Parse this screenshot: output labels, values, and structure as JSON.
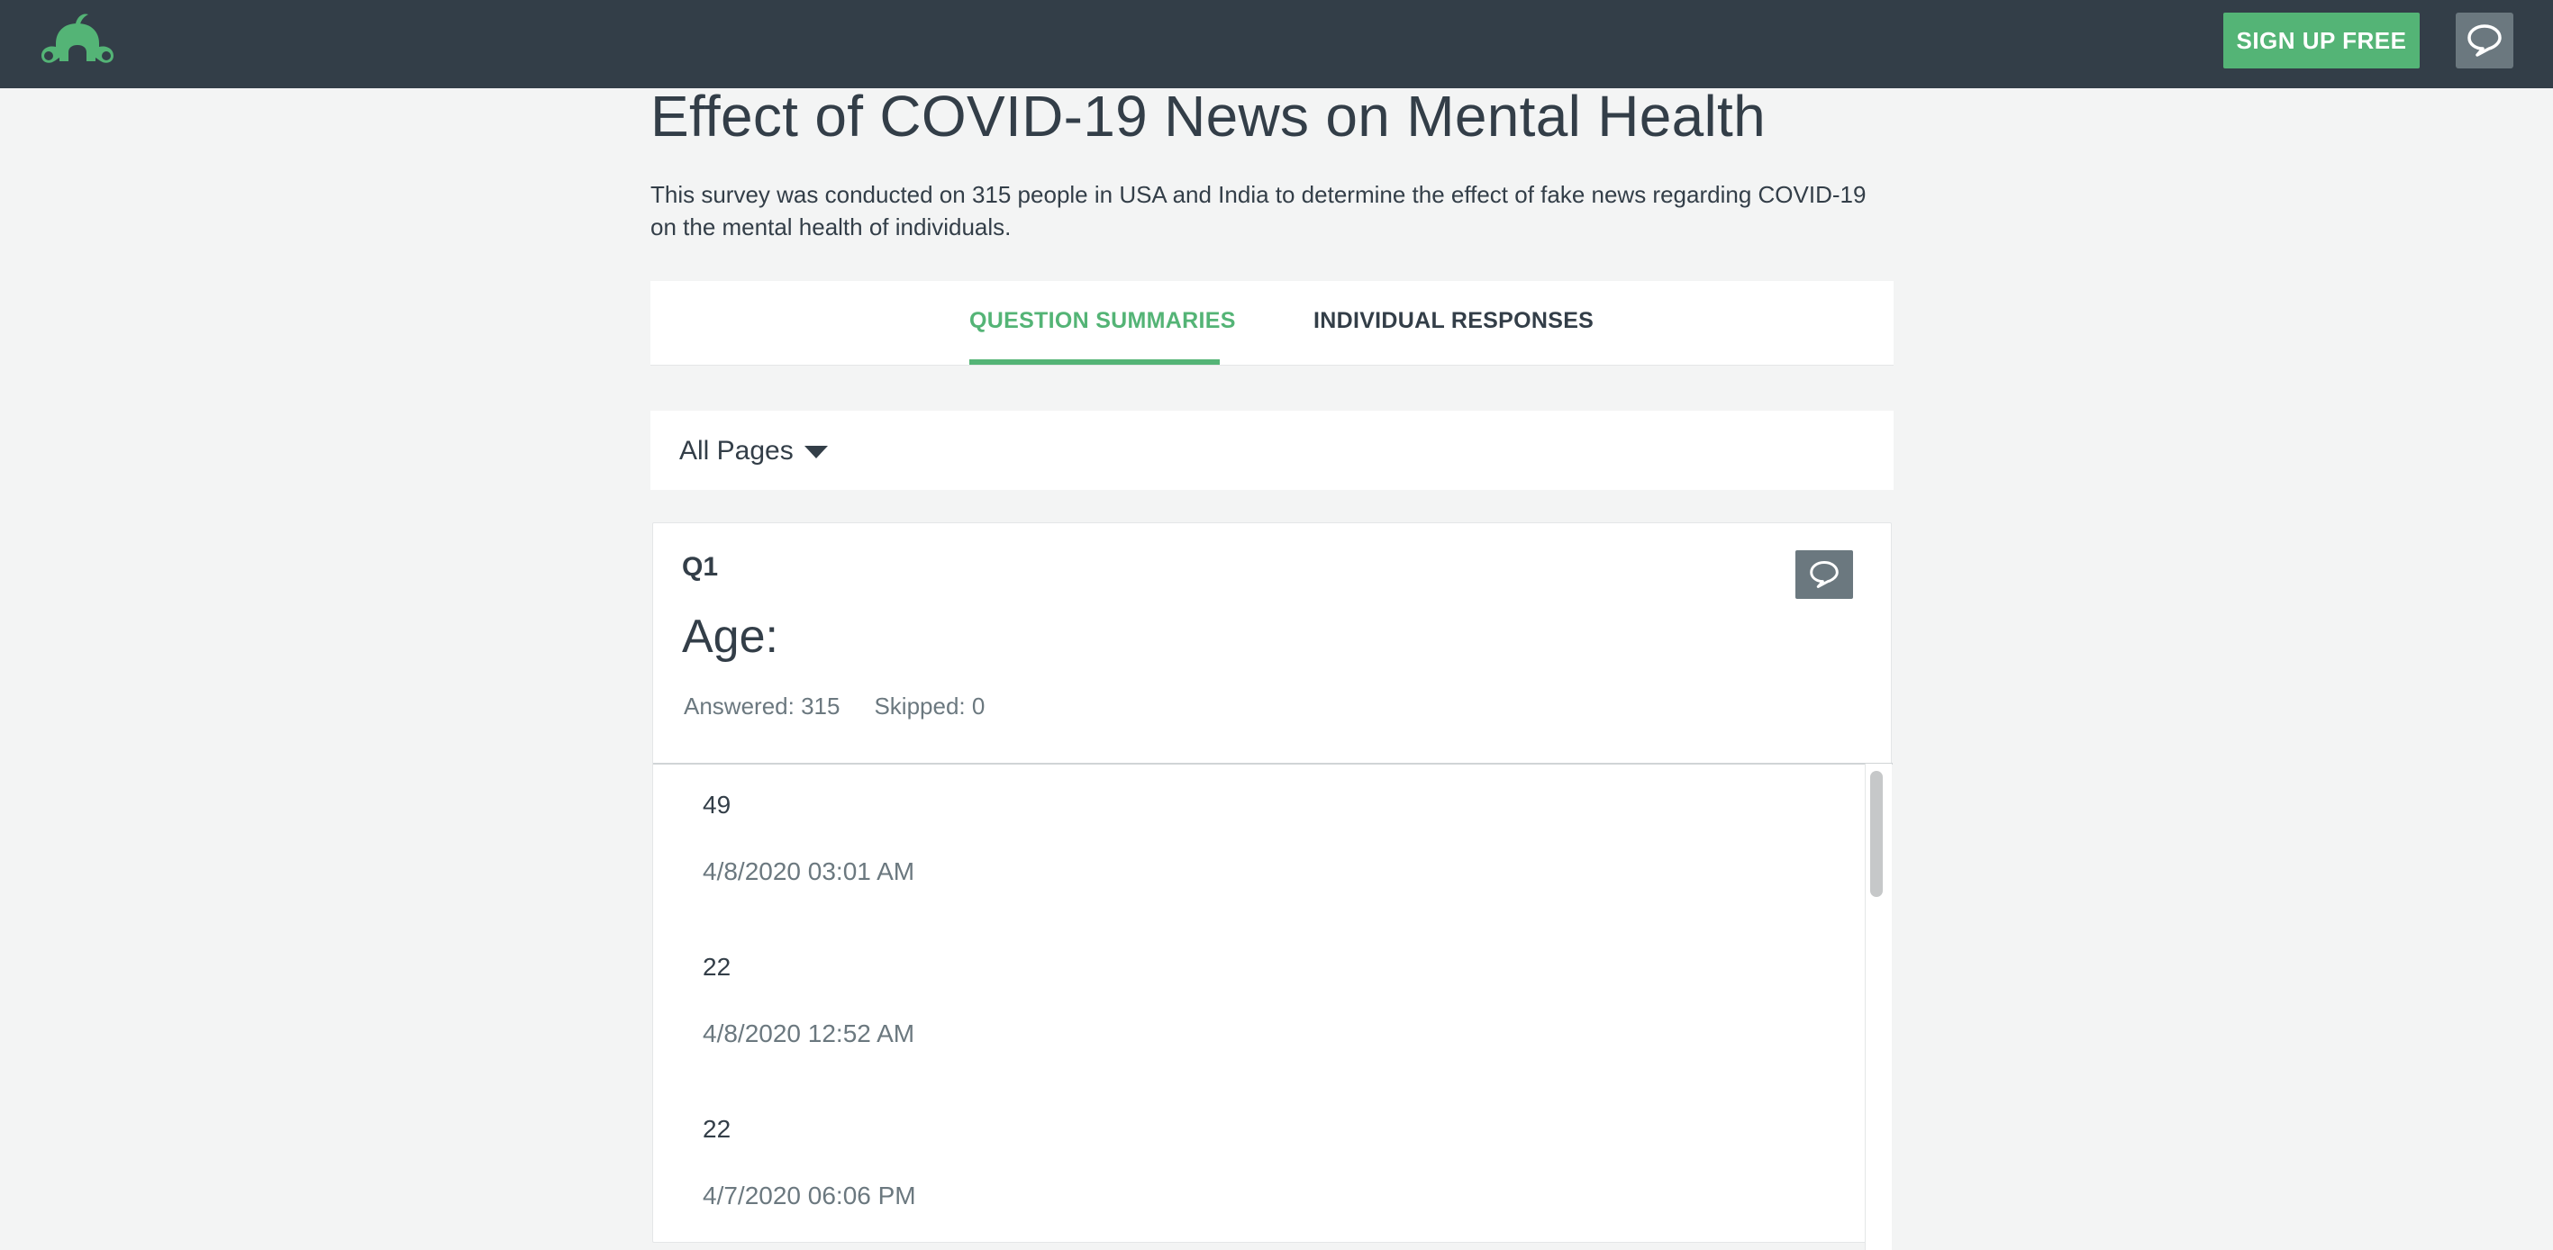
{
  "topbar": {
    "logo_icon": "surveymonkey-logo",
    "signup_label": "SIGN UP FREE",
    "chat_icon": "speech-bubble-icon",
    "accent": "#54b476",
    "background": "#333e48"
  },
  "survey": {
    "title": "Effect of COVID-19 News on Mental Health",
    "description": "This survey was conducted on 315 people in USA and India to determine the effect of fake news regarding COVID-19 on the mental health of individuals."
  },
  "tabs": [
    {
      "label": "QUESTION SUMMARIES",
      "active": true
    },
    {
      "label": "INDIVIDUAL RESPONSES",
      "active": false
    }
  ],
  "pages_filter": {
    "selected": "All Pages"
  },
  "question": {
    "number": "Q1",
    "text": "Age:",
    "answered": "Answered: 315",
    "skipped": "Skipped: 0",
    "comment_icon": "speech-bubble-icon",
    "responses": [
      {
        "value": "49",
        "date": "4/8/2020 03:01 AM"
      },
      {
        "value": "22",
        "date": "4/8/2020 12:52 AM"
      },
      {
        "value": "22",
        "date": "4/7/2020 06:06 PM"
      }
    ]
  }
}
